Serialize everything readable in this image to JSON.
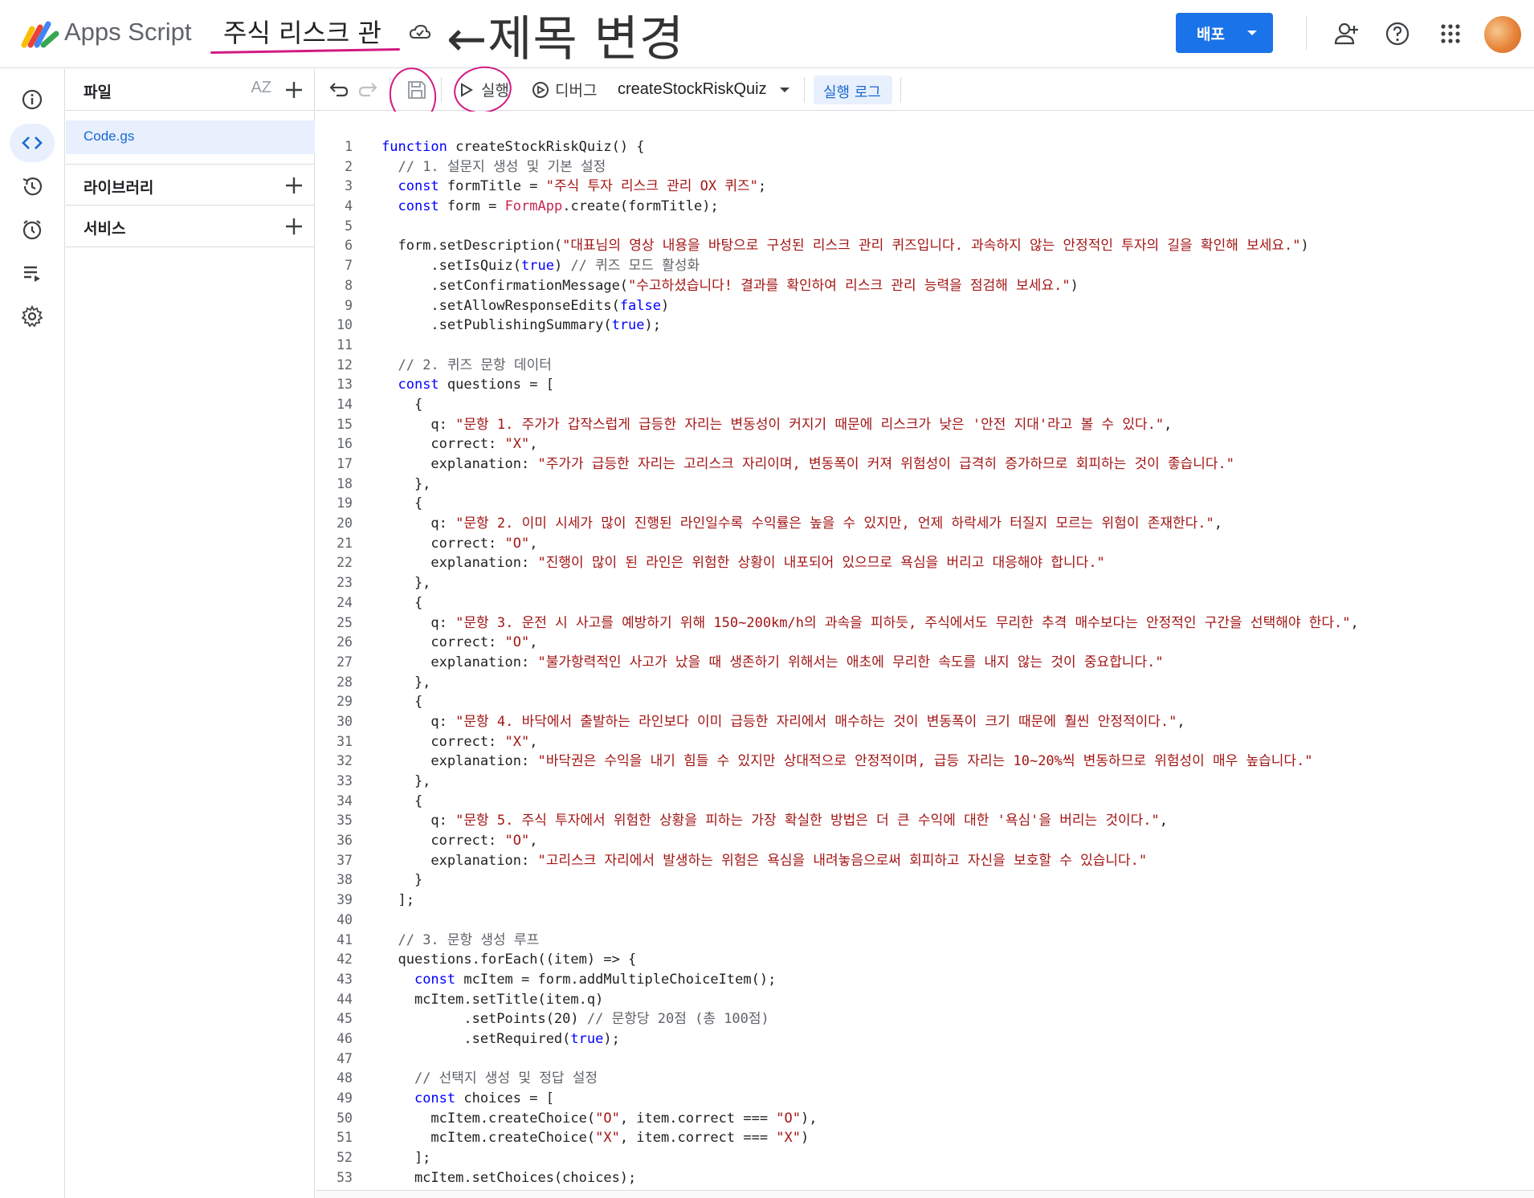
{
  "header": {
    "app_name": "Apps Script",
    "project_title": "주식 리스크 관",
    "annotation_text": "←제목 변경",
    "deploy_label": "배포"
  },
  "file_panel": {
    "files_header": "파일",
    "sort_label": "AZ",
    "files": [
      "Code.gs"
    ],
    "libraries_header": "라이브러리",
    "services_header": "서비스"
  },
  "toolbar": {
    "run_label": "실행",
    "debug_label": "디버그",
    "function_name": "createStockRiskQuiz",
    "log_label": "실행 로그"
  },
  "code": {
    "lines": [
      "function createStockRiskQuiz() {",
      "  // 1. 설문지 생성 및 기본 설정",
      "  const formTitle = \"주식 투자 리스크 관리 OX 퀴즈\";",
      "  const form = FormApp.create(formTitle);",
      "",
      "  form.setDescription(\"대표님의 영상 내용을 바탕으로 구성된 리스크 관리 퀴즈입니다. 과속하지 않는 안정적인 투자의 길을 확인해 보세요.\")",
      "      .setIsQuiz(true) // 퀴즈 모드 활성화",
      "      .setConfirmationMessage(\"수고하셨습니다! 결과를 확인하여 리스크 관리 능력을 점검해 보세요.\")",
      "      .setAllowResponseEdits(false)",
      "      .setPublishingSummary(true);",
      "",
      "  // 2. 퀴즈 문항 데이터",
      "  const questions = [",
      "    {",
      "      q: \"문항 1. 주가가 갑작스럽게 급등한 자리는 변동성이 커지기 때문에 리스크가 낮은 '안전 지대'라고 볼 수 있다.\",",
      "      correct: \"X\",",
      "      explanation: \"주가가 급등한 자리는 고리스크 자리이며, 변동폭이 커져 위험성이 급격히 증가하므로 회피하는 것이 좋습니다.\"",
      "    },",
      "    {",
      "      q: \"문항 2. 이미 시세가 많이 진행된 라인일수록 수익률은 높을 수 있지만, 언제 하락세가 터질지 모르는 위험이 존재한다.\",",
      "      correct: \"O\",",
      "      explanation: \"진행이 많이 된 라인은 위험한 상황이 내포되어 있으므로 욕심을 버리고 대응해야 합니다.\"",
      "    },",
      "    {",
      "      q: \"문항 3. 운전 시 사고를 예방하기 위해 150~200km/h의 과속을 피하듯, 주식에서도 무리한 추격 매수보다는 안정적인 구간을 선택해야 한다.\",",
      "      correct: \"O\",",
      "      explanation: \"불가항력적인 사고가 났을 때 생존하기 위해서는 애초에 무리한 속도를 내지 않는 것이 중요합니다.\"",
      "    },",
      "    {",
      "      q: \"문항 4. 바닥에서 출발하는 라인보다 이미 급등한 자리에서 매수하는 것이 변동폭이 크기 때문에 훨씬 안정적이다.\",",
      "      correct: \"X\",",
      "      explanation: \"바닥권은 수익을 내기 힘들 수 있지만 상대적으로 안정적이며, 급등 자리는 10~20%씩 변동하므로 위험성이 매우 높습니다.\"",
      "    },",
      "    {",
      "      q: \"문항 5. 주식 투자에서 위험한 상황을 피하는 가장 확실한 방법은 더 큰 수익에 대한 '욕심'을 버리는 것이다.\",",
      "      correct: \"O\",",
      "      explanation: \"고리스크 자리에서 발생하는 위험은 욕심을 내려놓음으로써 회피하고 자신을 보호할 수 있습니다.\"",
      "    }",
      "  ];",
      "",
      "  // 3. 문항 생성 루프",
      "  questions.forEach((item) => {",
      "    const mcItem = form.addMultipleChoiceItem();",
      "    mcItem.setTitle(item.q)",
      "          .setPoints(20) // 문항당 20점 (총 100점)",
      "          .setRequired(true);",
      "",
      "    // 선택지 생성 및 정답 설정",
      "    const choices = [",
      "      mcItem.createChoice(\"O\", item.correct === \"O\"),",
      "      mcItem.createChoice(\"X\", item.correct === \"X\")",
      "    ];",
      "    mcItem.setChoices(choices);"
    ]
  }
}
